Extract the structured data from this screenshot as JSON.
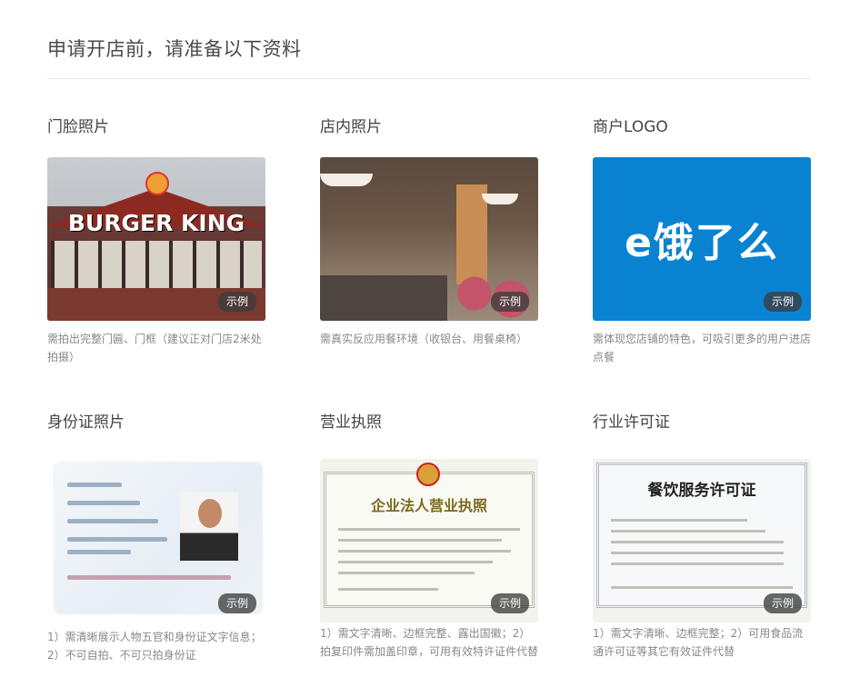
{
  "page": {
    "title": "申请开店前，请准备以下资料"
  },
  "badge_label": "示例",
  "cards": [
    {
      "title": "门脸照片",
      "image_text": "BURGER KING",
      "desc_lines": [
        "需拍出完整门匾、门框（建议正对门店2米处",
        "拍摄）"
      ]
    },
    {
      "title": "店内照片",
      "desc_lines": [
        "需真实反应用餐环境（收银台、用餐桌椅）"
      ]
    },
    {
      "title": "商户LOGO",
      "image_text": "e饿了么",
      "desc_lines": [
        "需体现您店铺的特色，可吸引更多的用户进店",
        "点餐"
      ]
    },
    {
      "title": "身份证照片",
      "desc_lines": [
        "1）需清晰展示人物五官和身份证文字信息；",
        "2）不可自拍、不可只拍身份证"
      ]
    },
    {
      "title": "营业执照",
      "image_text": "企业法人营业执照",
      "desc_lines": [
        "1）需文字清晰、边框完整、露出国徽；2）",
        "拍复印件需加盖印章，可用有效特许证件代替"
      ]
    },
    {
      "title": "行业许可证",
      "image_text": "餐饮服务许可证",
      "desc_lines": [
        "1）需文字清晰、边框完整；2）可用食品流",
        "通许可证等其它有效证件代替"
      ]
    }
  ],
  "colors": {
    "logo_bg": "#0a82d2",
    "badge_bg": "#3c3c3c"
  }
}
